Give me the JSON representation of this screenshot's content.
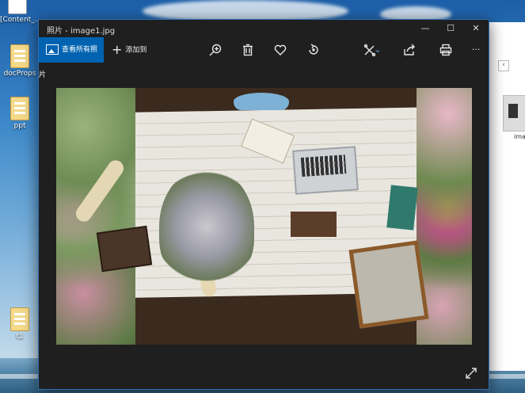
{
  "desktop": {
    "icons": [
      {
        "label": "[Content_...",
        "type": "doc"
      },
      {
        "label": "docProps",
        "type": "folder"
      },
      {
        "label": "ppt",
        "type": "folder"
      },
      {
        "label": "t1",
        "type": "folder"
      }
    ]
  },
  "explorer": {
    "chevron": "‹",
    "file_label": "ima"
  },
  "photos_window": {
    "title": "照片 - image1.jpg",
    "controls": {
      "minimize": "—",
      "maximize": "☐",
      "close": "✕"
    },
    "toolbar": {
      "see_all_label": "查看所有照片",
      "add_to_label": "添加到",
      "icons": [
        "zoom-in-icon",
        "delete-icon",
        "favorite-icon",
        "rotate-icon",
        "edit-icon",
        "share-icon",
        "print-icon",
        "more-icon"
      ],
      "dropdown_glyph": "⌄",
      "more_glyph": "···"
    },
    "photo": {
      "file": "image1.jpg"
    }
  },
  "colors": {
    "accent": "#0063b1",
    "window_bg": "#1f1f1f"
  }
}
